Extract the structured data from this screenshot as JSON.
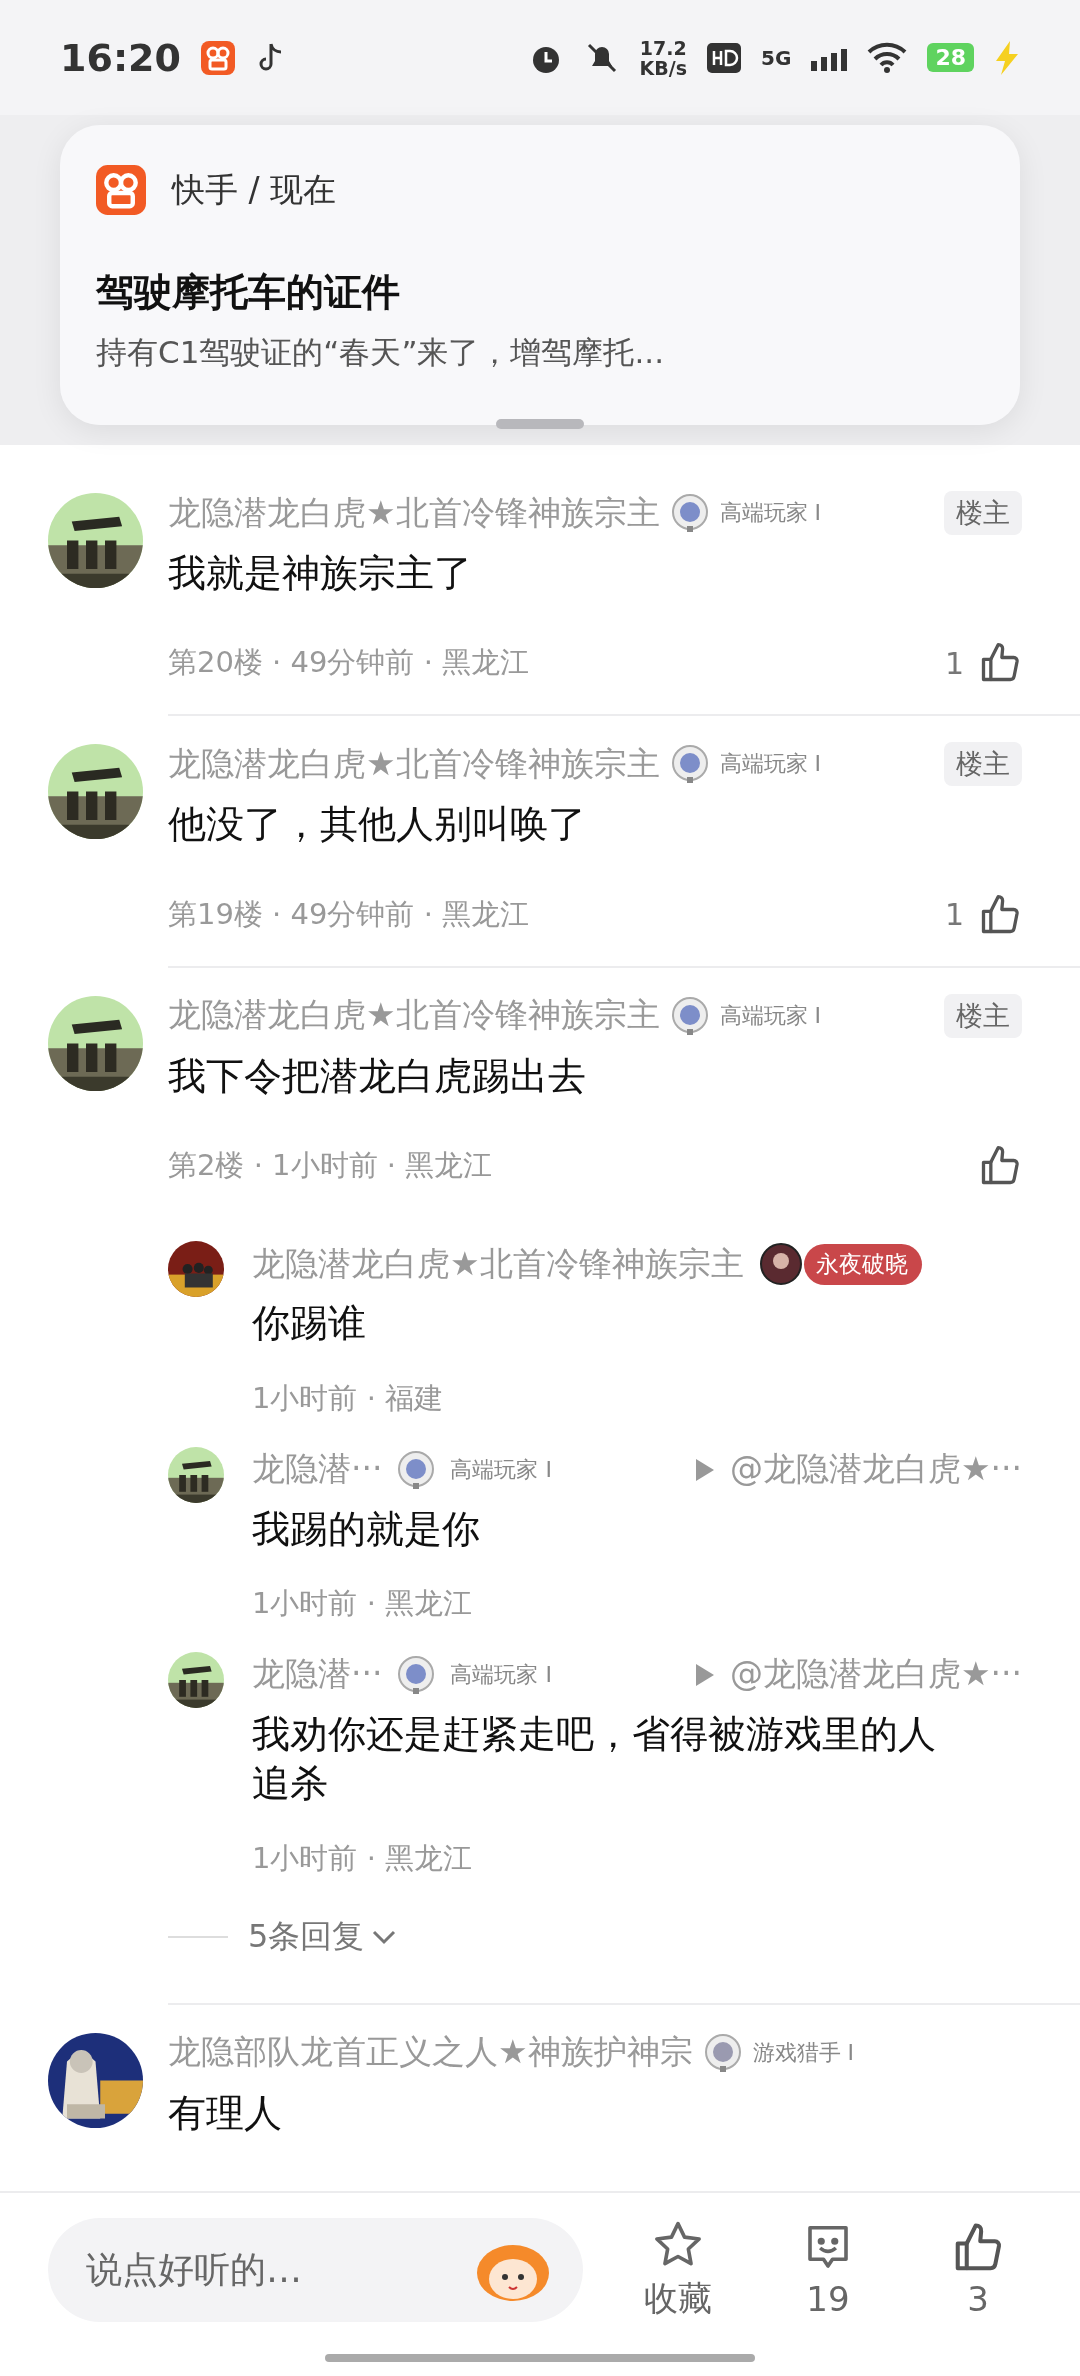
{
  "status_bar": {
    "time": "16:20",
    "speed_value": "17.2",
    "speed_unit": "KB/s",
    "network": "5G",
    "battery": "28"
  },
  "notification": {
    "source": "快手 / 现在",
    "title": "驾驶摩托车的证件",
    "body": "持有C1驾驶证的“春天”来了，增驾摩托..."
  },
  "comments": [
    {
      "name": "龙隐潜龙白虎★北首冷锋神族宗主",
      "badge": "高端玩家 I",
      "tag": "楼主",
      "text": "我就是神族宗主了",
      "meta": "第20楼 · 49分钟前 · 黑龙江",
      "likes": "1"
    },
    {
      "name": "龙隐潜龙白虎★北首冷锋神族宗主",
      "badge": "高端玩家 I",
      "tag": "楼主",
      "text": "他没了，其他人别叫唤了",
      "meta": "第19楼 · 49分钟前 · 黑龙江",
      "likes": "1"
    },
    {
      "name": "龙隐潜龙白虎★北首冷锋神族宗主",
      "badge": "高端玩家 I",
      "tag": "楼主",
      "text": "我下令把潜龙白虎踢出去",
      "meta": "第2楼 · 1小时前 · 黑龙江",
      "replies": [
        {
          "kind": "pill",
          "name": "龙隐潜龙白虎★北首冷锋神族宗主",
          "badge": "永夜破晓",
          "text": "你踢谁",
          "meta": "1小时前 · 福建"
        },
        {
          "kind": "plain",
          "name": "龙隐潜···",
          "badge": "高端玩家 I",
          "reply_to": "@龙隐潜龙白虎★···",
          "text": "我踢的就是你",
          "meta": "1小时前 · 黑龙江"
        },
        {
          "kind": "plain",
          "name": "龙隐潜···",
          "badge": "高端玩家 I",
          "reply_to": "@龙隐潜龙白虎★···",
          "text": "我劝你还是赶紧走吧，省得被游戏里的人追杀",
          "meta": "1小时前 · 黑龙江"
        }
      ],
      "more_replies": "5条回复"
    },
    {
      "name": "龙隐部队龙首正义之人★神族护神宗",
      "badge": "游戏猎手 I",
      "text": "有理人"
    }
  ],
  "bottom_bar": {
    "placeholder": "说点好听的…",
    "favorite": "收藏",
    "comment_count": "19",
    "like_count": "3"
  }
}
